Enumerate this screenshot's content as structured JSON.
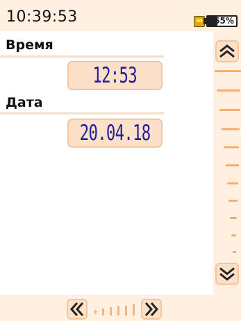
{
  "status_bar": {
    "time": "10:39:53",
    "sd_icon": "sd-card-icon",
    "battery_percent": 65,
    "battery_label": "65%"
  },
  "main": {
    "time_label": "Время",
    "time_value": "12:53",
    "date_label": "Дата",
    "date_value": "20.04.18"
  },
  "scrollbar": {
    "up_icon": "double-chevron-up-icon",
    "down_icon": "double-chevron-down-icon"
  },
  "pager": {
    "prev_icon": "double-chevron-left-icon",
    "next_icon": "double-chevron-right-icon"
  },
  "colors": {
    "background": "#fff0e2",
    "value_box": "#fde0c8",
    "value_text": "#1f1f9c",
    "accent": "#f3ae70"
  }
}
